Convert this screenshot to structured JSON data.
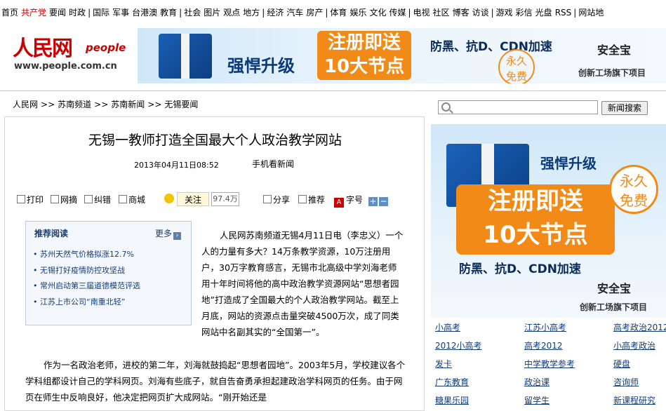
{
  "topnav": {
    "groups": [
      [
        "首页",
        "共产党",
        "要闻",
        "时政"
      ],
      [
        "国际",
        "军事",
        "台港澳",
        "教育"
      ],
      [
        "社会",
        "图片",
        "观点",
        "地方"
      ],
      [
        "经济",
        "汽车",
        "房产"
      ],
      [
        "体育",
        "娱乐",
        "文化",
        "传媒"
      ],
      [
        "电视",
        "社区",
        "博客",
        "访谈"
      ],
      [
        "游戏",
        "彩信",
        "光盘",
        "RSS"
      ],
      [
        "网站地"
      ]
    ],
    "highlight": "共产党"
  },
  "logo": {
    "brand": "人民网",
    "people": "people",
    "url": "www.people.com.cn"
  },
  "top_banner": {
    "slogan1": "强悍升级",
    "main_line1": "注册即送",
    "main_line2": "10大节点",
    "features": "防黑、抗D、CDN加速",
    "badge_line1": "永久",
    "badge_line2": "免费",
    "brand": "安全宝",
    "tagline": "创新工场旗下项目"
  },
  "breadcrumb": [
    "人民网",
    "苏南频道",
    "苏南新闻",
    "无锡要闻"
  ],
  "breadcrumb_sep": ">>",
  "search": {
    "placeholder": "",
    "button": "新闻搜索"
  },
  "article": {
    "title": "无锡一教师打造全国最大个人政治教学网站",
    "datetime": "2013年04月11日08:52",
    "mobile_link": "手机看新闻",
    "tools": {
      "print": "打印",
      "bookmark": "网摘",
      "error": "纠错",
      "shop": "商城",
      "follow": "关注",
      "follow_count": "97.4万",
      "share": "分享",
      "recommend": "推荐",
      "font_size": "字号",
      "font_plus": "+",
      "font_minus": "−"
    },
    "recommend_box": {
      "heading": "推荐阅读",
      "more": "更多",
      "items": [
        "苏州天然气价格拟涨12.7%",
        "无锡打好疫情防控攻坚战",
        "常州启动第三届道德模范评选",
        "江苏上市公司“南重北轻”"
      ]
    },
    "para1": "人民网苏南频道无锡4月11日电（李忠义）一个人的力量有多大？14万条教学资源，10万注册用户，30万字教育感言，无锡市北高级中学刘海老师用十年时间将他的高中政治教学资源网站“思想者园地”打造成了全国最大的个人政治教学网站。截至上月底，网站的资源点击量突破4500万次，成了同类网站中名副其实的“全国第一”。",
    "para2": "作为一名政治老师，进校的第二年，刘海就鼓捣起“思想者园地”。2003年5月，学校建议各个学科组都设计自己的学科网页。刘海有些底子，就自告奋勇承担起建政治学科网页的任务。由于网页在师生中反响良好，他决定把网页扩大成网站。“刚开始还是"
  },
  "side_ad": {
    "slogan1": "强悍升级",
    "main_line1": "注册即送",
    "main_line2": "10大节点",
    "features": "防黑、抗D、CDN加速",
    "badge_line1": "永久",
    "badge_line2": "免费",
    "brand": "安全宝",
    "tagline": "创新工场旗下项目"
  },
  "side_links": [
    [
      "小高考",
      "江苏小高考",
      "高考政治2012"
    ],
    [
      "2012小高考",
      "高考2012",
      "小高考政治"
    ],
    [
      "发卡",
      "中学教学参考",
      "硬盘"
    ],
    [
      "广东教育",
      "政治课",
      "咨询师"
    ],
    [
      "糖果乐园",
      "留学生",
      "新课程研究"
    ]
  ]
}
